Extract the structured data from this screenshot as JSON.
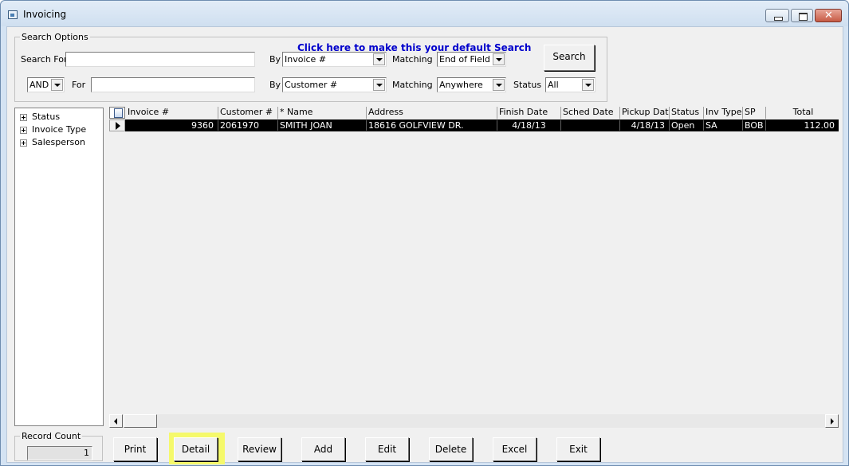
{
  "window": {
    "title": "Invoicing"
  },
  "search": {
    "group_label": "Search Options",
    "default_link": "Click here to make this your default Search",
    "search_for_label": "Search For",
    "search_for_value": "",
    "by_label": "By",
    "by1_value": "Invoice #",
    "matching_label": "Matching",
    "matching1_value": "End of Field",
    "conj_value": "AND",
    "for_label": "For",
    "for_value": "",
    "by2_value": "Customer #",
    "matching2_value": "Anywhere",
    "status_label": "Status",
    "status_value": "All",
    "search_button": "Search"
  },
  "tree": {
    "items": [
      {
        "label": "Status"
      },
      {
        "label": "Invoice Type"
      },
      {
        "label": "Salesperson"
      }
    ]
  },
  "grid": {
    "columns": [
      "Invoice #",
      "Customer #",
      "* Name",
      "Address",
      "Finish Date",
      "Sched Date",
      "Pickup Date",
      "Status",
      "Inv Type",
      "SP",
      "Total"
    ],
    "rows": [
      {
        "invoice": "9360",
        "customer": "2061970",
        "name": "SMITH JOAN",
        "address": "18616 GOLFVIEW DR.",
        "finish_date": "4/18/13",
        "sched_date": "",
        "pickup_date": "4/18/13",
        "status": "Open",
        "inv_type": "SA",
        "sp": "BOB",
        "total": "112.00"
      }
    ]
  },
  "record_count": {
    "label": "Record Count",
    "value": "1"
  },
  "buttons": {
    "print": "Print",
    "detail": "Detail",
    "review": "Review",
    "add": "Add",
    "edit": "Edit",
    "delete": "Delete",
    "excel": "Excel",
    "exit": "Exit"
  },
  "colors": {
    "highlight": "#f5f96b",
    "link": "#0000cc",
    "selected_row_bg": "#000000"
  }
}
